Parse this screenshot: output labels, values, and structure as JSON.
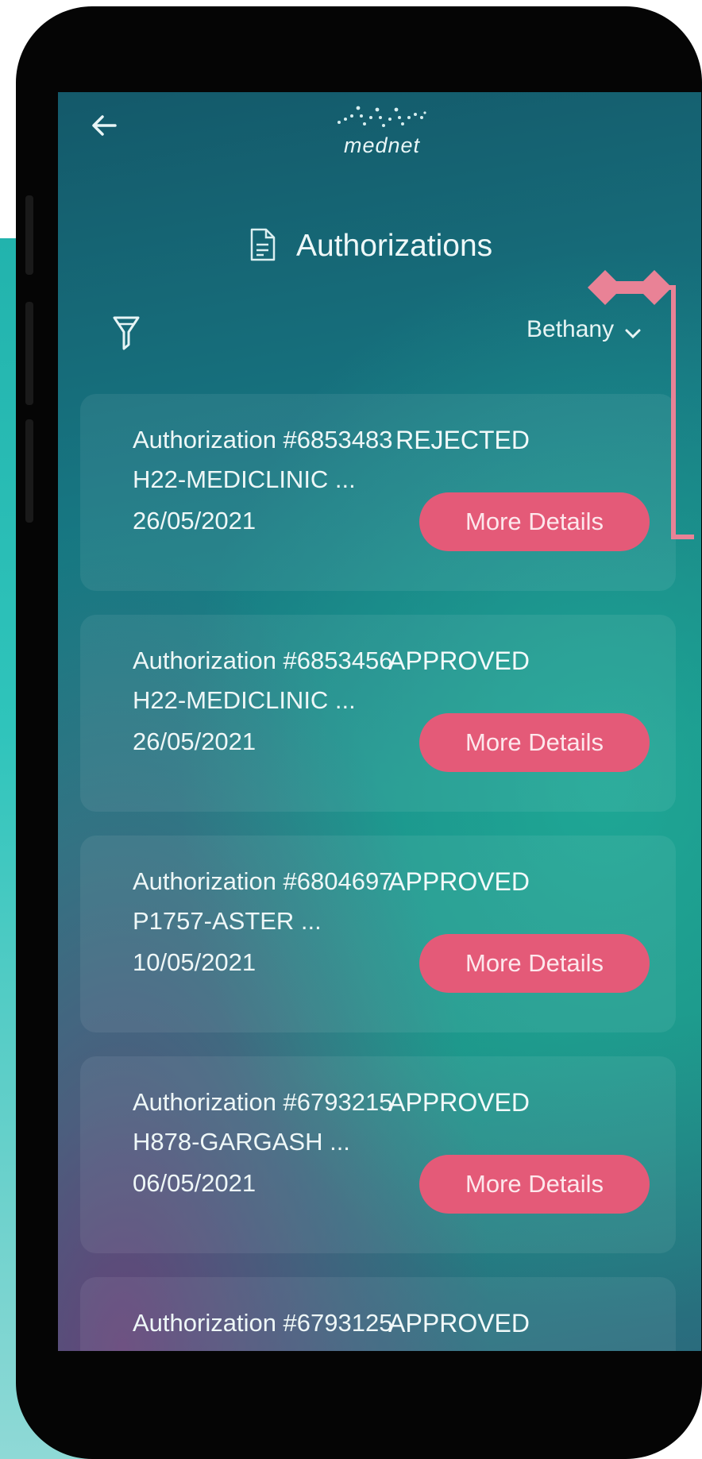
{
  "header": {
    "logo_text": "mednet",
    "title": "Authorizations"
  },
  "filter": {
    "member_name": "Bethany"
  },
  "authorizations": [
    {
      "number": "Authorization #6853483",
      "provider": "H22-MEDICLINIC ...",
      "date": "26/05/2021",
      "status": "REJECTED",
      "action": "More Details"
    },
    {
      "number": "Authorization #6853456",
      "provider": "H22-MEDICLINIC ...",
      "date": "26/05/2021",
      "status": "APPROVED",
      "action": "More Details"
    },
    {
      "number": "Authorization #6804697",
      "provider": "P1757-ASTER ...",
      "date": "10/05/2021",
      "status": "APPROVED",
      "action": "More Details"
    },
    {
      "number": "Authorization #6793215",
      "provider": "H878-GARGASH ...",
      "date": "06/05/2021",
      "status": "APPROVED",
      "action": "More Details"
    },
    {
      "number": "Authorization #6793125",
      "status": "APPROVED"
    }
  ],
  "colors": {
    "accent": "#e45a78",
    "callout": "#e98296",
    "side_panel": "#22b3ad"
  }
}
